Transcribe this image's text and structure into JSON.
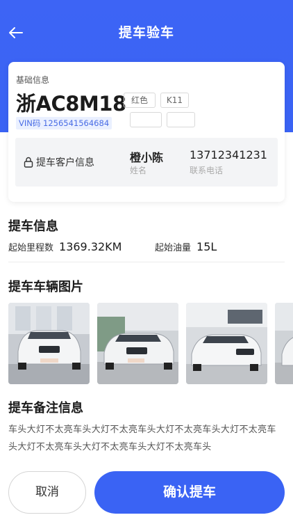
{
  "header": {
    "title": "提车验车",
    "back_icon": "arrow-left-icon"
  },
  "vehicle": {
    "section_label": "基础信息",
    "plate": "浙AC8M18",
    "color": "红色",
    "model": "K11",
    "vin": "VIN码 1256541564684"
  },
  "customer": {
    "label": "提车客户信息",
    "name": "橙小陈",
    "name_caption": "姓名",
    "phone": "13712341231",
    "phone_caption": "联系电话"
  },
  "pickup_info": {
    "title": "提车信息",
    "mileage_label": "起始里程数",
    "mileage_value": "1369.32KM",
    "fuel_label": "起始油量",
    "fuel_value": "15L"
  },
  "photos": {
    "title": "提车车辆图片"
  },
  "remarks": {
    "title": "提车备注信息",
    "text": "车头大灯不太亮车头大灯不太亮车头大灯不太亮车头大灯不太亮车头大灯不太亮车头大灯不太亮车头大灯不太亮车头"
  },
  "actions": {
    "cancel": "取消",
    "confirm": "确认提车"
  },
  "colors": {
    "primary": "#3a63f4",
    "vin_bg": "#eaf0ff",
    "panel_bg": "#f3f4f6"
  }
}
